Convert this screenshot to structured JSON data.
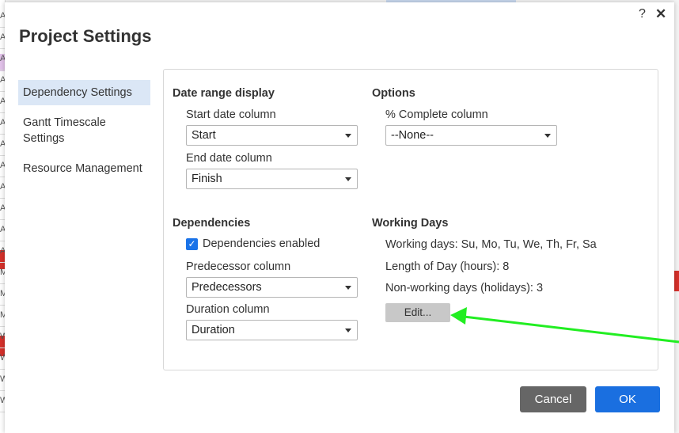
{
  "background": {
    "left_letters": [
      "A",
      "A",
      "A",
      "A",
      "A",
      "A",
      "A",
      "A",
      "A",
      "A",
      "A",
      "A",
      "M",
      "M",
      "M",
      "W",
      "W",
      "W",
      "W"
    ]
  },
  "dialog": {
    "title": "Project Settings",
    "help_icon": "?",
    "close_icon": "✕"
  },
  "nav": {
    "items": [
      {
        "label": "Dependency Settings",
        "active": true
      },
      {
        "label": "Gantt Timescale Settings",
        "active": false
      },
      {
        "label": "Resource Management",
        "active": false
      }
    ]
  },
  "date_range": {
    "title": "Date range display",
    "start_label": "Start date column",
    "start_value": "Start",
    "end_label": "End date column",
    "end_value": "Finish"
  },
  "options": {
    "title": "Options",
    "complete_label": "% Complete column",
    "complete_value": "--None--"
  },
  "dependencies": {
    "title": "Dependencies",
    "enabled_label": "Dependencies enabled",
    "enabled": true,
    "predecessor_label": "Predecessor column",
    "predecessor_value": "Predecessors",
    "duration_label": "Duration column",
    "duration_value": "Duration"
  },
  "working_days": {
    "title": "Working Days",
    "days_text": "Working days: Su, Mo, Tu, We, Th, Fr, Sa",
    "length_text": "Length of Day (hours): 8",
    "holidays_text": "Non-working days (holidays): 3",
    "edit_label": "Edit..."
  },
  "footer": {
    "cancel_label": "Cancel",
    "ok_label": "OK"
  },
  "colors": {
    "primary": "#1a6fe0",
    "annotation_arrow": "#22ee22"
  }
}
